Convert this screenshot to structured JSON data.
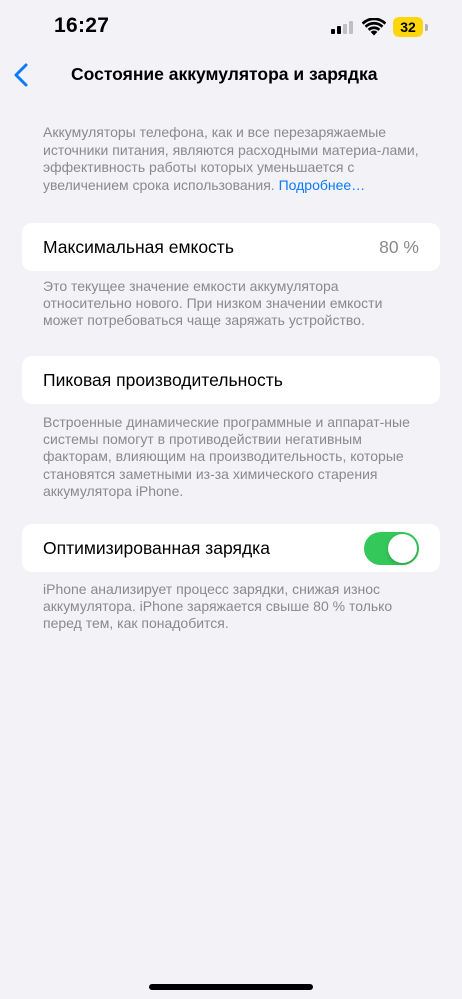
{
  "status_bar": {
    "time": "16:27",
    "battery_level": "32",
    "battery_color": "#ffd60a",
    "signal_icon": "cellular-signal-icon",
    "wifi_icon": "wifi-icon"
  },
  "nav": {
    "back_icon": "chevron-left-icon",
    "title": "Состояние аккумулятора и зарядка"
  },
  "intro": {
    "text": "Аккумуляторы телефона, как и все перезаряжаемые источники питания, являются расходными материа-лами, эффективность работы которых уменьшается с увеличением срока использования. ",
    "link": "Подробнее…"
  },
  "max_capacity": {
    "label": "Максимальная емкость",
    "value": "80 %",
    "footnote": "Это текущее значение емкости аккумулятора относительно нового. При низком значении емкости может потребоваться чаще заряжать устройство."
  },
  "peak_performance": {
    "label": "Пиковая производительность",
    "footnote": "Встроенные динамические программные и аппарат-ные системы помогут в противодействии негативным факторам, влияющим на производительность, которые становятся заметными из-за химического старения аккумулятора iPhone."
  },
  "optimized_charging": {
    "label": "Оптимизированная зарядка",
    "enabled": true,
    "toggle_color": "#34c759",
    "footnote": "iPhone анализирует процесс зарядки, снижая износ аккумулятора. iPhone заряжается свыше 80 % только перед тем, как понадобится."
  },
  "colors": {
    "background": "#f2f2f7",
    "accent": "#0a7aff",
    "secondary_text": "#8a8a8e"
  }
}
